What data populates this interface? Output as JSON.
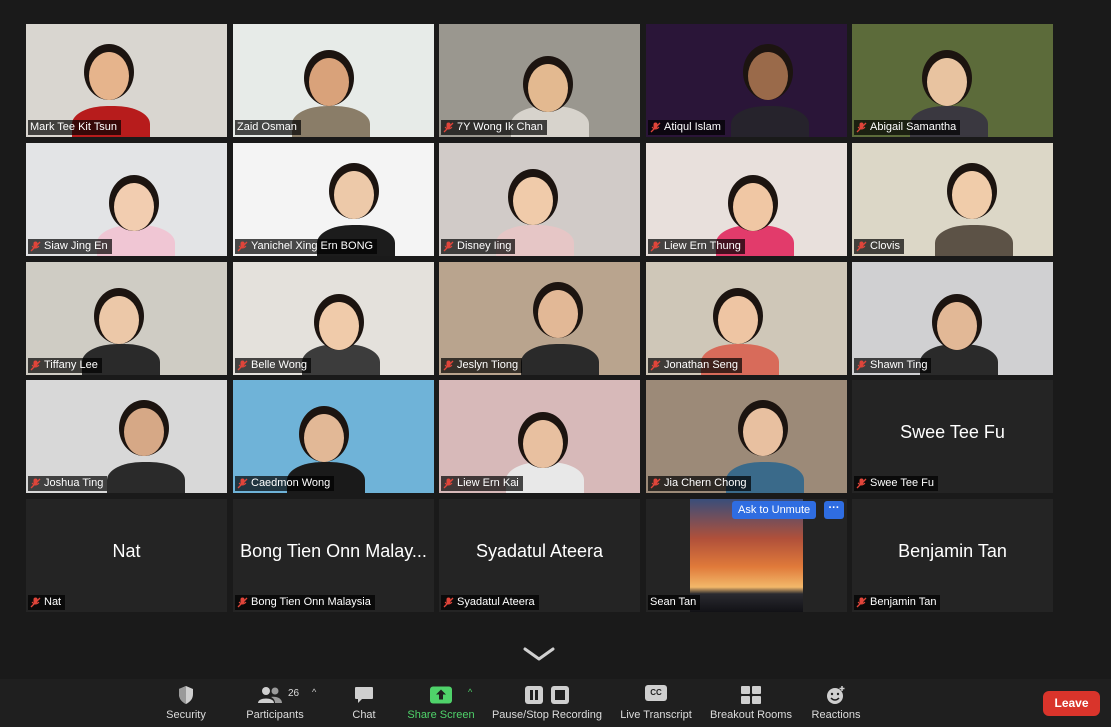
{
  "participants_grid": [
    {
      "name": "Mark Tee Kit Tsun",
      "muted": false,
      "video": true,
      "bg": "#d9d6d0",
      "shirt": "#b71c1c",
      "skin": "#e6b48c"
    },
    {
      "name": "Zaid Osman",
      "muted": false,
      "video": true,
      "active_speaker": true,
      "bg": "#e7ebe8",
      "shirt": "#8a7d68",
      "skin": "#d9a27a"
    },
    {
      "name": "7Y Wong Ik Chan",
      "muted": true,
      "video": true,
      "bg": "#9a978f",
      "shirt": "#d7d3cc",
      "skin": "#e3b990"
    },
    {
      "name": "Atiqul Islam",
      "muted": true,
      "video": true,
      "bg": "#2a1538",
      "shirt": "#26232c",
      "skin": "#9a6a4a"
    },
    {
      "name": "Abigail Samantha",
      "muted": true,
      "video": true,
      "bg": "#5c6b3a",
      "shirt": "#3a3840",
      "skin": "#e8c3a0"
    },
    {
      "name": "Siaw Jing En",
      "muted": true,
      "video": true,
      "bg": "#e3e4e6",
      "shirt": "#f0c6d4",
      "skin": "#f2cdb0"
    },
    {
      "name": "Yanichel Xing Ern BONG",
      "muted": true,
      "video": true,
      "bg": "#f4f4f4",
      "shirt": "#1c1c1c",
      "skin": "#edc9a9"
    },
    {
      "name": "Disney Iing",
      "muted": true,
      "video": true,
      "bg": "#d1cbc8",
      "shirt": "#e6c6c6",
      "skin": "#f0cbaa"
    },
    {
      "name": "Liew Ern Thung",
      "muted": true,
      "video": true,
      "bg": "#e8e0dc",
      "shirt": "#e23b6b",
      "skin": "#f0c7a4"
    },
    {
      "name": "Clovis",
      "muted": true,
      "video": true,
      "bg": "#dcd7c7",
      "shirt": "#5c5246",
      "skin": "#f0ccaa"
    },
    {
      "name": "Tiffany Lee",
      "muted": true,
      "video": true,
      "bg": "#cfccc4",
      "shirt": "#2a2a2a",
      "skin": "#ecc8a8"
    },
    {
      "name": "Belle Wong",
      "muted": true,
      "video": true,
      "bg": "#e4e1dc",
      "shirt": "#3c3c3c",
      "skin": "#f0cbaa"
    },
    {
      "name": "Jeslyn Tiong",
      "muted": true,
      "video": true,
      "bg": "#b9a48e",
      "shirt": "#2a2a2a",
      "skin": "#e2b896"
    },
    {
      "name": "Jonathan Seng",
      "muted": true,
      "video": true,
      "bg": "#cfc7b8",
      "shirt": "#d86b5a",
      "skin": "#eec5a3"
    },
    {
      "name": "Shawn Ting",
      "muted": true,
      "video": true,
      "bg": "#d0d0d2",
      "shirt": "#2a2a2a",
      "skin": "#e2b896"
    },
    {
      "name": "Joshua Ting",
      "muted": true,
      "video": true,
      "bg": "#d8d8d8",
      "shirt": "#2a2a2a",
      "skin": "#d6a886"
    },
    {
      "name": "Caedmon Wong",
      "muted": true,
      "video": true,
      "bg": "#6fb3d8",
      "shirt": "#1a1a1a",
      "skin": "#e2b896"
    },
    {
      "name": "Liew Ern Kai",
      "muted": true,
      "video": true,
      "bg": "#d7b9b9",
      "shirt": "#e8e8e8",
      "skin": "#e8c0a0"
    },
    {
      "name": "Jia Chern Chong",
      "muted": true,
      "video": true,
      "bg": "#9c8a78",
      "shirt": "#3a6a8a",
      "skin": "#e8c0a0"
    },
    {
      "name": "Swee Tee Fu",
      "muted": true,
      "video": false,
      "display": "Swee Tee Fu"
    },
    {
      "name": "Nat",
      "muted": true,
      "video": false,
      "display": "Nat"
    },
    {
      "name": "Bong Tien Onn Malaysia",
      "muted": true,
      "video": false,
      "display": "Bong Tien Onn Malay..."
    },
    {
      "name": "Syadatul Ateera",
      "muted": true,
      "video": false,
      "display": "Syadatul Ateera"
    },
    {
      "name": "Sean Tan",
      "muted": false,
      "video": true,
      "sunset": true,
      "bg": "#1a1a1a"
    },
    {
      "name": "Benjamin Tan",
      "muted": true,
      "video": false,
      "display": "Benjamin Tan"
    }
  ],
  "unmute_prompt": {
    "label": "Ask to Unmute",
    "more": "···"
  },
  "toolbar": {
    "security": "Security",
    "participants": "Participants",
    "participants_count": "26",
    "chat": "Chat",
    "share_screen": "Share Screen",
    "recording": "Pause/Stop Recording",
    "transcript": "Live Transcript",
    "transcript_icon_text": "CC",
    "breakout": "Breakout Rooms",
    "reactions": "Reactions",
    "leave": "Leave"
  },
  "colors": {
    "leave": "#d9342b",
    "share_green": "#4fd26a",
    "unmute_blue": "#2f6de1",
    "active_outline": "#f5e27a"
  }
}
